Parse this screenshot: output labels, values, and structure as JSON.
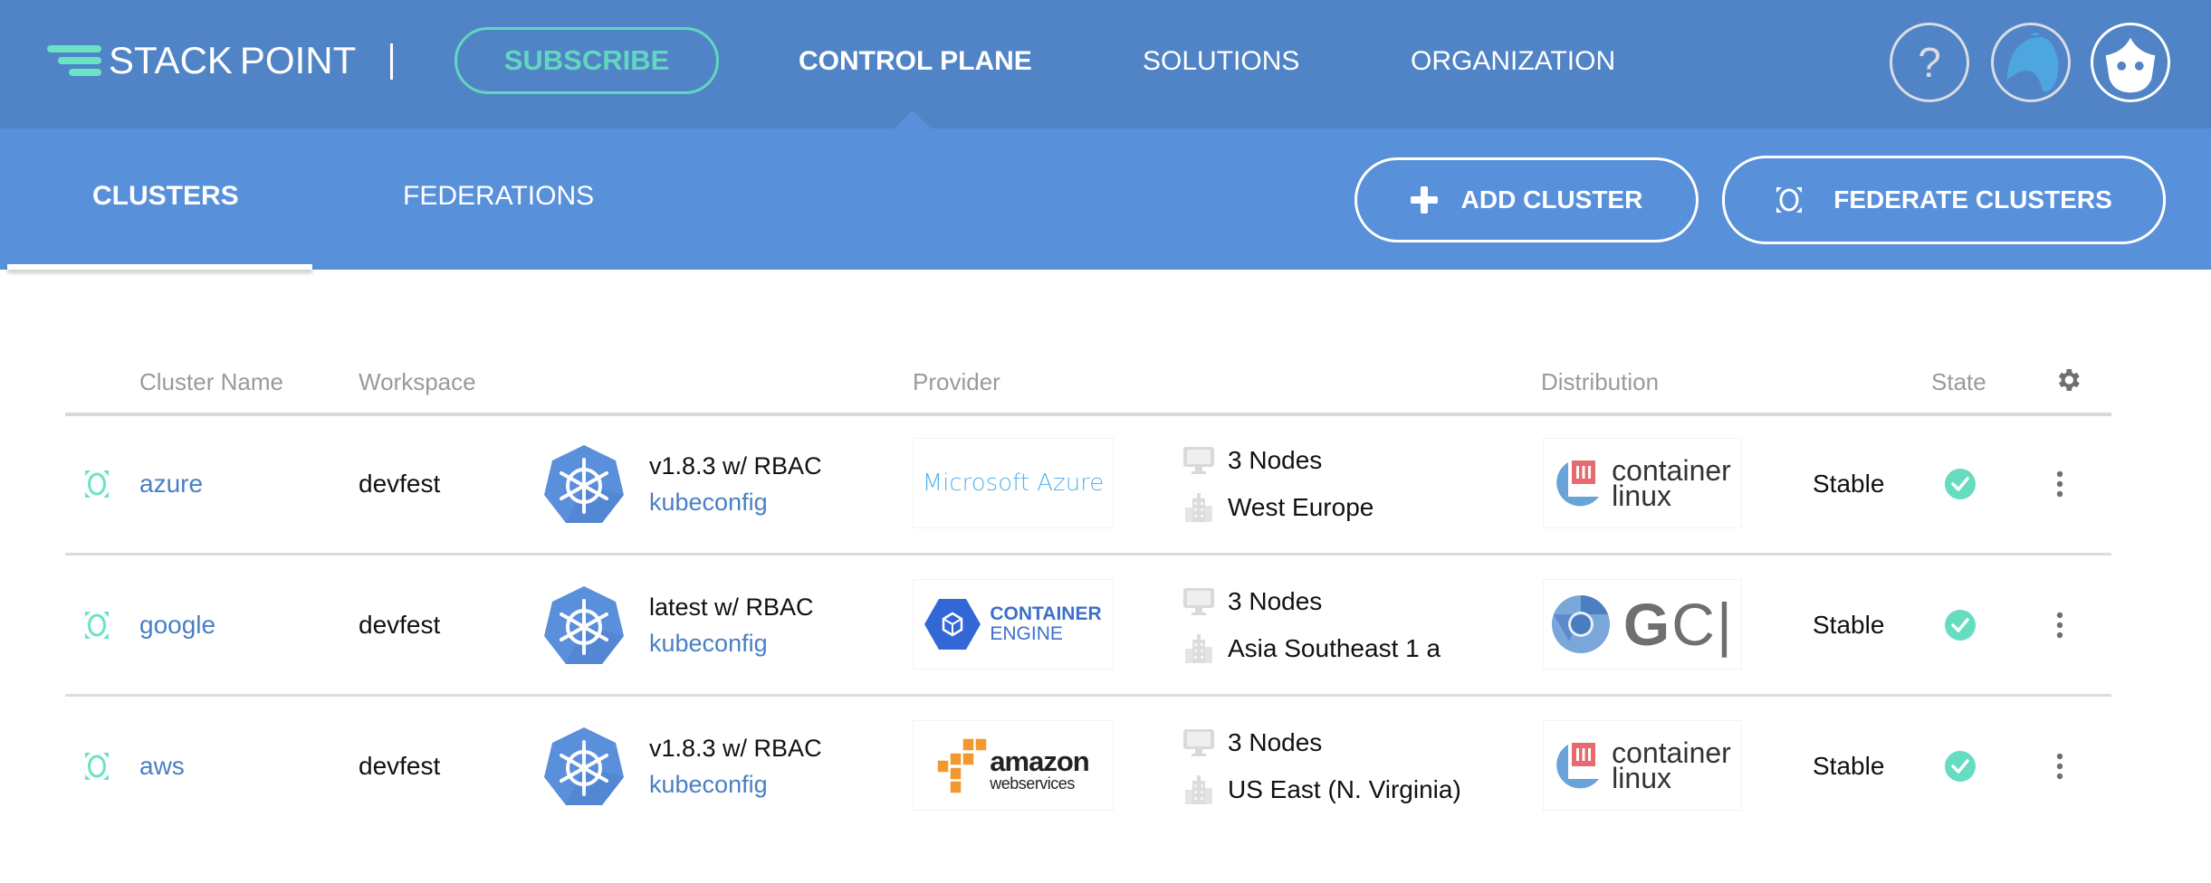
{
  "brand": {
    "name_bold": "STACK",
    "name_light": "POINT"
  },
  "header": {
    "subscribe_label": "SUBSCRIBE",
    "nav": [
      {
        "label": "CONTROL PLANE",
        "active": true
      },
      {
        "label": "SOLUTIONS",
        "active": false
      },
      {
        "label": "ORGANIZATION",
        "active": false
      }
    ],
    "icons": [
      "help-icon",
      "bear-icon",
      "user-avatar-icon"
    ],
    "help_glyph": "?"
  },
  "subnav": {
    "tabs": [
      {
        "label": "CLUSTERS",
        "active": true
      },
      {
        "label": "FEDERATIONS",
        "active": false
      }
    ],
    "add_cluster_label": "ADD CLUSTER",
    "federate_clusters_label": "FEDERATE CLUSTERS"
  },
  "table": {
    "columns": [
      "Cluster Name",
      "Workspace",
      "Provider",
      "Distribution",
      "State"
    ],
    "rows": [
      {
        "name": "azure",
        "workspace": "devfest",
        "version": "v1.8.3 w/ RBAC",
        "kubeconfig": "kubeconfig",
        "provider": "Microsoft Azure",
        "nodes": "3 Nodes",
        "region": "West Europe",
        "distribution": "container linux",
        "state": "Stable"
      },
      {
        "name": "google",
        "workspace": "devfest",
        "version": "latest w/ RBAC",
        "kubeconfig": "kubeconfig",
        "provider": "CONTAINER ENGINE",
        "nodes": "3 Nodes",
        "region": "Asia Southeast 1 a",
        "distribution": "GCI",
        "state": "Stable"
      },
      {
        "name": "aws",
        "workspace": "devfest",
        "version": "v1.8.3 w/ RBAC",
        "kubeconfig": "kubeconfig",
        "provider": "amazon web services",
        "nodes": "3 Nodes",
        "region": "US East (N. Virginia)",
        "distribution": "container linux",
        "state": "Stable"
      }
    ]
  },
  "logos": {
    "azure": "Microsoft Azure",
    "gke_line1": "CONTAINER",
    "gke_line2": "ENGINE",
    "aws_line1": "amazon",
    "aws_line2": "webservices",
    "cl_line1": "container",
    "cl_line2": "linux",
    "gci": "GCI"
  },
  "colors": {
    "topbar": "#5084c6",
    "subbar": "#5990da",
    "accent_teal": "#62d6be",
    "link_blue": "#4a7fc4",
    "stable_green": "#66dcc1"
  }
}
